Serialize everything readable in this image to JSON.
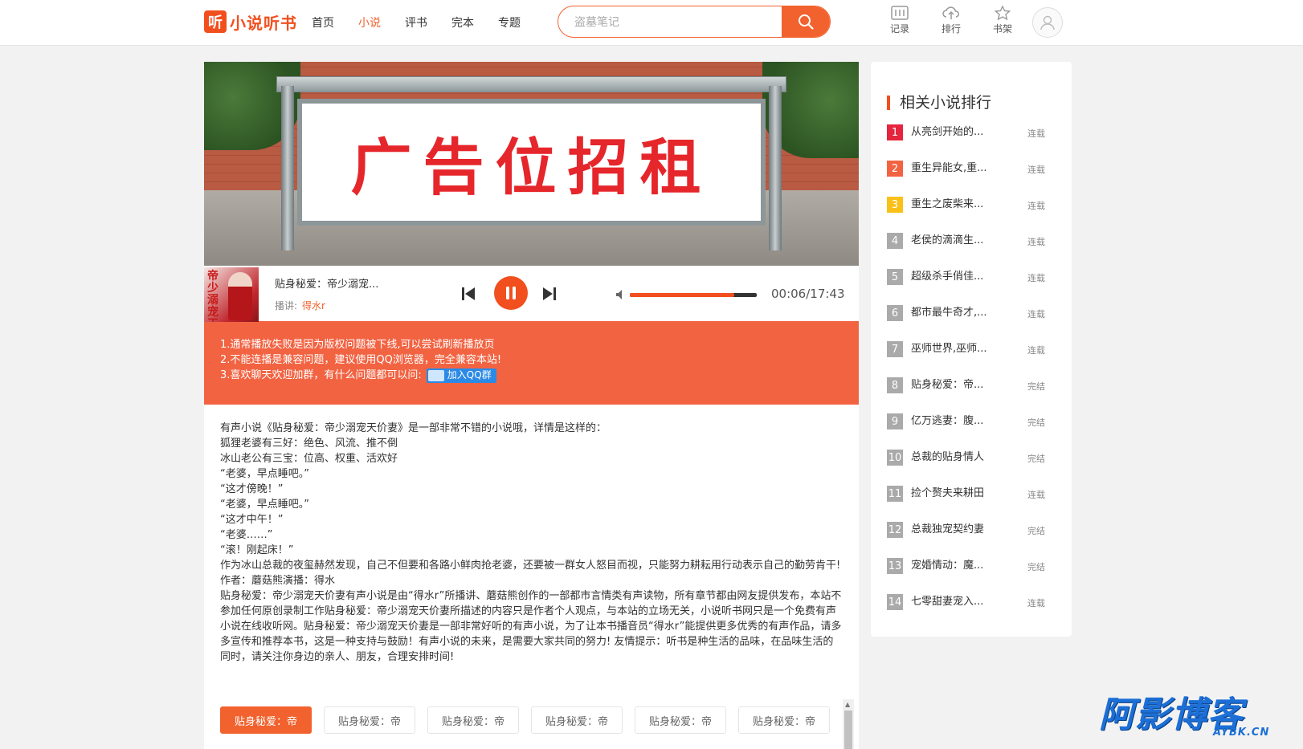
{
  "header": {
    "logo_mark": "听",
    "logo_text": "小说听书",
    "nav": [
      {
        "label": "首页",
        "active": false
      },
      {
        "label": "小说",
        "active": true
      },
      {
        "label": "评书",
        "active": false
      },
      {
        "label": "完本",
        "active": false
      },
      {
        "label": "专题",
        "active": false
      }
    ],
    "search": {
      "placeholder": "盗墓笔记",
      "value": ""
    },
    "tools": [
      {
        "label": "记录",
        "icon": "history-icon"
      },
      {
        "label": "排行",
        "icon": "rank-upload-icon"
      },
      {
        "label": "书架",
        "icon": "star-icon"
      }
    ]
  },
  "banner": {
    "text": "广告位招租"
  },
  "player": {
    "cover_text": "帝少溺宠天价妻",
    "title": "贴身秘爱：帝少溺宠...",
    "narrator_label": "播讲:",
    "narrator": "得水r",
    "time": "00:06/17:43",
    "progress": 0.82
  },
  "notice": {
    "line1": "1.通常播放失败是因为版权问题被下线,可以尝试刷新播放页",
    "line2": "2.不能连播是兼容问题，建议使用QQ浏览器，完全兼容本站!",
    "line3": "3.喜欢聊天欢迎加群，有什么问题都可以问:",
    "qq_button": "加入QQ群"
  },
  "description": [
    "有声小说《贴身秘爱：帝少溺宠天价妻》是一部非常不错的小说哦，详情是这样的：",
    "狐狸老婆有三好：绝色、风流、推不倒",
    "冰山老公有三宝：位高、权重、活欢好",
    "“老婆，早点睡吧。”",
    "“这才傍晚！”",
    "“老婆，早点睡吧。”",
    "“这才中午！”",
    "“老婆……”",
    "“滚！刚起床！”",
    "作为冰山总裁的夜玺赫然发现，自己不但要和各路小鲜肉抢老婆，还要被一群女人怒目而视，只能努力耕耘用行动表示自己的勤劳肯干!",
    "作者：蘑菇熊演播：得水",
    "贴身秘爱：帝少溺宠天价妻有声小说是由“得水r”所播讲、蘑菇熊创作的一部都市言情类有声读物，所有章节都由网友提供发布，本站不参加任何原创录制工作贴身秘爱：帝少溺宠天价妻所描述的内容只是作者个人观点，与本站的立场无关，小说听书网只是一个免费有声小说在线收听网。贴身秘爱：帝少溺宠天价妻是一部非常好听的有声小说，为了让本书播音员“得水r”能提供更多优秀的有声作品，请多多宣传和推荐本书，这是一种支持与鼓励！有声小说的未来，是需要大家共同的努力! 友情提示：听书是种生活的品味，在品味生活的同时，请关注你身边的亲人、朋友，合理安排时间!"
  ],
  "chapters": [
    {
      "label": "贴身秘爱：帝",
      "active": true
    },
    {
      "label": "贴身秘爱：帝",
      "active": false
    },
    {
      "label": "贴身秘爱：帝",
      "active": false
    },
    {
      "label": "贴身秘爱：帝",
      "active": false
    },
    {
      "label": "贴身秘爱：帝",
      "active": false
    },
    {
      "label": "贴身秘爱：帝",
      "active": false
    }
  ],
  "sidebar": {
    "title": "相关小说排行",
    "items": [
      {
        "num": "1",
        "name": "从亮剑开始的...",
        "status": "连载"
      },
      {
        "num": "2",
        "name": "重生异能女,重...",
        "status": "连载"
      },
      {
        "num": "3",
        "name": "重生之废柴来...",
        "status": "连载"
      },
      {
        "num": "4",
        "name": "老侯的滴滴生...",
        "status": "连载"
      },
      {
        "num": "5",
        "name": "超级杀手俏佳...",
        "status": "连载"
      },
      {
        "num": "6",
        "name": "都市最牛奇才,...",
        "status": "连载"
      },
      {
        "num": "7",
        "name": "巫师世界,巫师...",
        "status": "连载"
      },
      {
        "num": "8",
        "name": "贴身秘爱：帝...",
        "status": "完结"
      },
      {
        "num": "9",
        "name": "亿万逃妻：腹...",
        "status": "完结"
      },
      {
        "num": "10",
        "name": "总裁的贴身情人",
        "status": "完结"
      },
      {
        "num": "11",
        "name": "捡个赘夫来耕田",
        "status": "连载"
      },
      {
        "num": "12",
        "name": "总裁独宠契约妻",
        "status": "完结"
      },
      {
        "num": "13",
        "name": "宠婚情动：魔...",
        "status": "完结"
      },
      {
        "num": "14",
        "name": "七零甜妻宠入...",
        "status": "连载"
      }
    ]
  },
  "watermark": {
    "big": "阿影博客",
    "small": "AYBK.CN"
  },
  "colors": {
    "accent": "#f2622e",
    "notice_bg": "#f26342",
    "rank1": "#e5243d",
    "rank2": "#f26342",
    "rank3": "#f9c118"
  }
}
